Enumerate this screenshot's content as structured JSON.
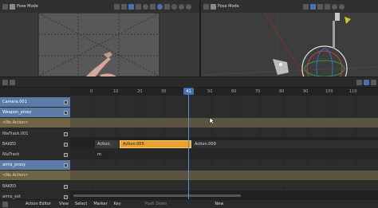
{
  "viewport_left": {
    "mode_label": "Pose Mode"
  },
  "viewport_right": {
    "mode_label": "Pose Mode"
  },
  "timeline": {
    "ticks": [
      "0",
      "10",
      "20",
      "30",
      "41",
      "50",
      "60",
      "70",
      "80",
      "90",
      "100",
      "110"
    ],
    "current_frame": "41"
  },
  "tracks": [
    {
      "label": "Camera.001",
      "style": "blue"
    },
    {
      "label": "Weapon_proxy",
      "style": "blue"
    },
    {
      "label": "<No Action>",
      "style": "gold"
    },
    {
      "label": "NlaTrack.001",
      "style": "dark"
    },
    {
      "label": "BAKED",
      "style": "dark"
    },
    {
      "label": "NlaTrack",
      "style": "dark"
    },
    {
      "label": "arms_proxy",
      "style": "blue"
    },
    {
      "label": "<No Action>",
      "style": "gold"
    },
    {
      "label": "BAKED",
      "style": "dark"
    },
    {
      "label": "arms_ext",
      "style": "dark"
    }
  ],
  "strips": {
    "s1": "Action.",
    "s2": "Action.005",
    "s3": "Action.009",
    "s4": "m"
  },
  "footer": {
    "editor": "Action Editor",
    "view": "View",
    "select": "Select",
    "marker": "Marker",
    "key": "Key",
    "push_down": "Push Down",
    "new": "New"
  },
  "colors": {
    "accent": "#4772b3",
    "strip_active": "#e8a234",
    "playhead": "#5a8fd6"
  }
}
